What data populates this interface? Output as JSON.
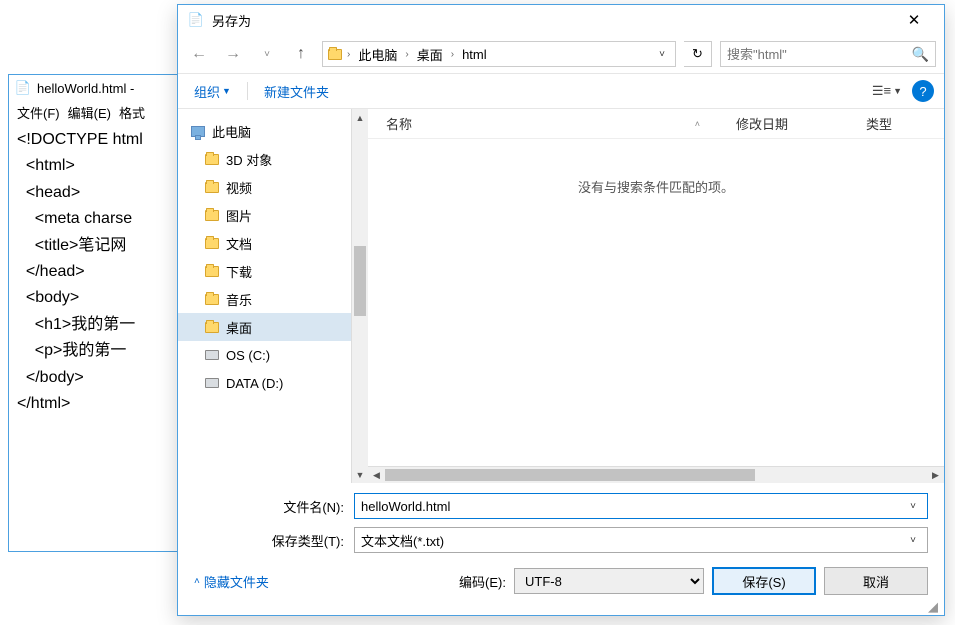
{
  "notepad": {
    "title": "helloWorld.html -",
    "menu": [
      "文件(F)",
      "编辑(E)",
      "格式"
    ],
    "content": "<!DOCTYPE html\n  <html>\n  <head>\n    <meta charse\n    <title>笔记网\n  </head>\n  <body>\n    <h1>我的第一\n    <p>我的第一\n  </body>\n</html>"
  },
  "dialog": {
    "title": "另存为",
    "breadcrumb": [
      "此电脑",
      "桌面",
      "html"
    ],
    "search_placeholder": "搜索\"html\"",
    "toolbar": {
      "organize": "组织",
      "new_folder": "新建文件夹"
    },
    "tree": [
      {
        "label": "此电脑",
        "icon": "pc",
        "top": true
      },
      {
        "label": "3D 对象",
        "icon": "folder"
      },
      {
        "label": "视频",
        "icon": "folder"
      },
      {
        "label": "图片",
        "icon": "folder"
      },
      {
        "label": "文档",
        "icon": "folder"
      },
      {
        "label": "下载",
        "icon": "folder"
      },
      {
        "label": "音乐",
        "icon": "folder"
      },
      {
        "label": "桌面",
        "icon": "folder",
        "selected": true
      },
      {
        "label": "OS (C:)",
        "icon": "drive"
      },
      {
        "label": "DATA (D:)",
        "icon": "drive"
      }
    ],
    "columns": {
      "name": "名称",
      "date": "修改日期",
      "type": "类型"
    },
    "empty_msg": "没有与搜索条件匹配的项。",
    "filename_label": "文件名(N):",
    "filename_value": "helloWorld.html",
    "type_label": "保存类型(T):",
    "type_value": "文本文档(*.txt)",
    "hide_folders": "隐藏文件夹",
    "encoding_label": "编码(E):",
    "encoding_value": "UTF-8",
    "save_btn": "保存(S)",
    "cancel_btn": "取消"
  }
}
